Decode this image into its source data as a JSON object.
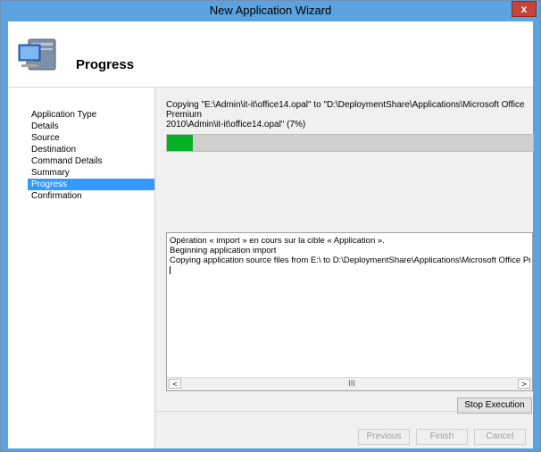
{
  "window": {
    "title": "New Application Wizard",
    "close_label": "x"
  },
  "header": {
    "title": "Progress",
    "icon": "computer-icon"
  },
  "sidebar": {
    "items": [
      {
        "label": "Application Type"
      },
      {
        "label": "Details"
      },
      {
        "label": "Source"
      },
      {
        "label": "Destination"
      },
      {
        "label": "Command Details"
      },
      {
        "label": "Summary"
      },
      {
        "label": "Progress",
        "active": true
      },
      {
        "label": "Confirmation"
      }
    ]
  },
  "progress": {
    "message_line1": "Copying \"E:\\Admin\\it-it\\office14.opal\" to \"D:\\DeploymentShare\\Applications\\Microsoft Office Premium",
    "message_line2": "2010\\Admin\\it-it\\office14.opal\" (7%)",
    "percent": 7,
    "fill_color": "#06b025"
  },
  "log": {
    "lines": [
      "Opération « import » en cours sur la cible « Application ».",
      "Beginning application import",
      "Copying application source files from E:\\ to D:\\DeploymentShare\\Applications\\Microsoft Office Premium"
    ],
    "scroll_left": "<",
    "scroll_right": ">",
    "scroll_thumb": "III"
  },
  "buttons": {
    "stop": "Stop Execution",
    "previous": "Previous",
    "finish": "Finish",
    "cancel": "Cancel"
  },
  "colors": {
    "title_bar": "#5aa2e0",
    "active_nav": "#3399ff",
    "close_button": "#c7443b"
  }
}
